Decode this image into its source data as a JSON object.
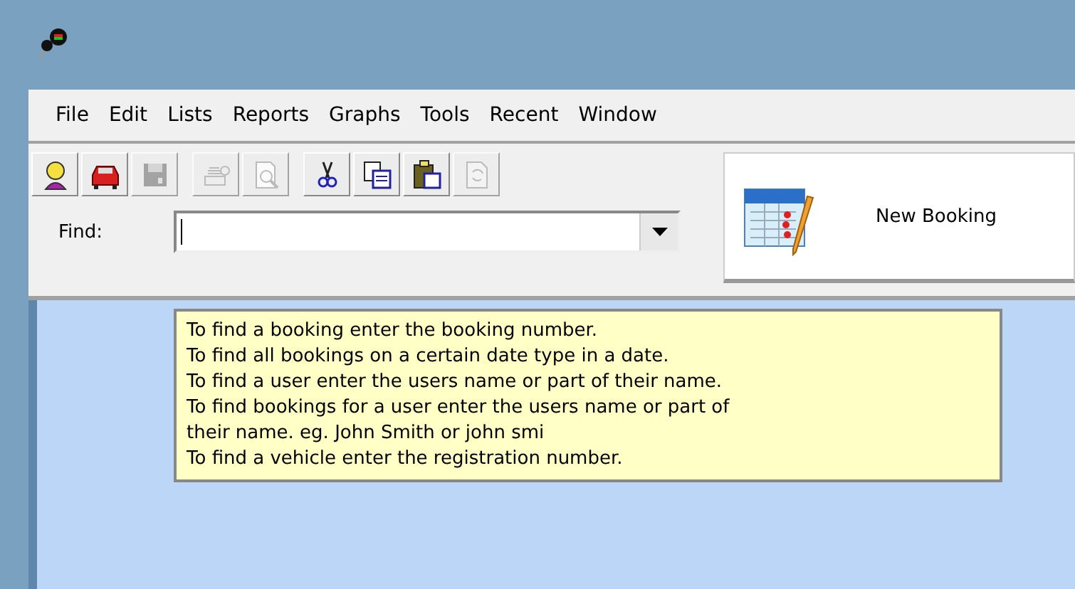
{
  "menu": [
    "File",
    "Edit",
    "Lists",
    "Reports",
    "Graphs",
    "Tools",
    "Recent",
    "Window"
  ],
  "toolbar": {
    "groups": [
      [
        {
          "disabled": false
        },
        {
          "disabled": false
        },
        {
          "disabled": true
        }
      ],
      [
        {
          "disabled": true
        },
        {
          "disabled": true
        }
      ],
      [
        {
          "disabled": false
        },
        {
          "disabled": false
        },
        {
          "disabled": false
        },
        {
          "disabled": true
        }
      ]
    ]
  },
  "find": {
    "label": "Find:"
  },
  "new_booking": {
    "label": "New Booking"
  },
  "tooltip": {
    "lines": [
      "To find a booking enter the booking number.",
      "To find all bookings on a certain date type in a date.",
      "To find a user enter the users name or part of their name.",
      "To find bookings for a user enter the users name or part of",
      "their name. eg. John Smith or john smi",
      "To find a vehicle enter the registration number."
    ]
  }
}
